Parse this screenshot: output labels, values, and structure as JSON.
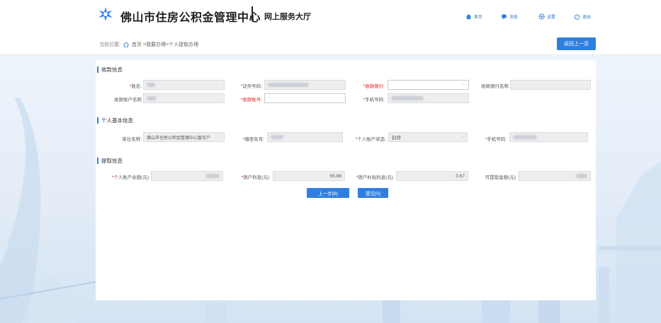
{
  "header": {
    "site_name": "佛山市住房公积金管理中心",
    "separator": "|",
    "portal_name": "网上服务大厅",
    "nav": [
      {
        "label": "首页",
        "icon": "home-icon"
      },
      {
        "label": "消息",
        "icon": "message-icon"
      },
      {
        "label": "设置",
        "icon": "settings-icon"
      },
      {
        "label": "退出",
        "icon": "power-icon"
      }
    ]
  },
  "breadcrumb": {
    "prefix": "当前位置:",
    "path": "首页 >我要办理>个人提取办理",
    "back_label": "返回上一页"
  },
  "sections": {
    "payee": {
      "title": "收款信息",
      "name_label": "姓名:",
      "id_label": "证件号码:",
      "bank_label": "收款银行:",
      "bank_name_label": "收款银行名称",
      "account_name_label": "收款账户名称",
      "account_no_label": "收款账号:",
      "phone_label": "手机号码:",
      "bank_value": "",
      "bank_name_value": "",
      "account_no_value": ""
    },
    "personal": {
      "title": "个人基本信息",
      "unit_label": "单位名称:",
      "unit_value": "佛山市住房公积金管理中心暂存户",
      "paid_until_label": "缴至年月:",
      "status_label": "个人账户状态:",
      "status_value": "封存",
      "phone_label": "手机号码:"
    },
    "withdraw": {
      "title": "提取信息",
      "balance_label": "个人账户余额(元)",
      "interest_label": "销户利息(元)",
      "interest_value": "65.86",
      "subsidy_label": "销户补贴利息(元)",
      "subsidy_value": "0.67",
      "available_label": "可提取金额(元)"
    }
  },
  "actions": {
    "prev_label": "上一步[B]",
    "submit_label": "提交[S]"
  },
  "colors": {
    "accent": "#2f7fe0",
    "required": "#e02020"
  }
}
